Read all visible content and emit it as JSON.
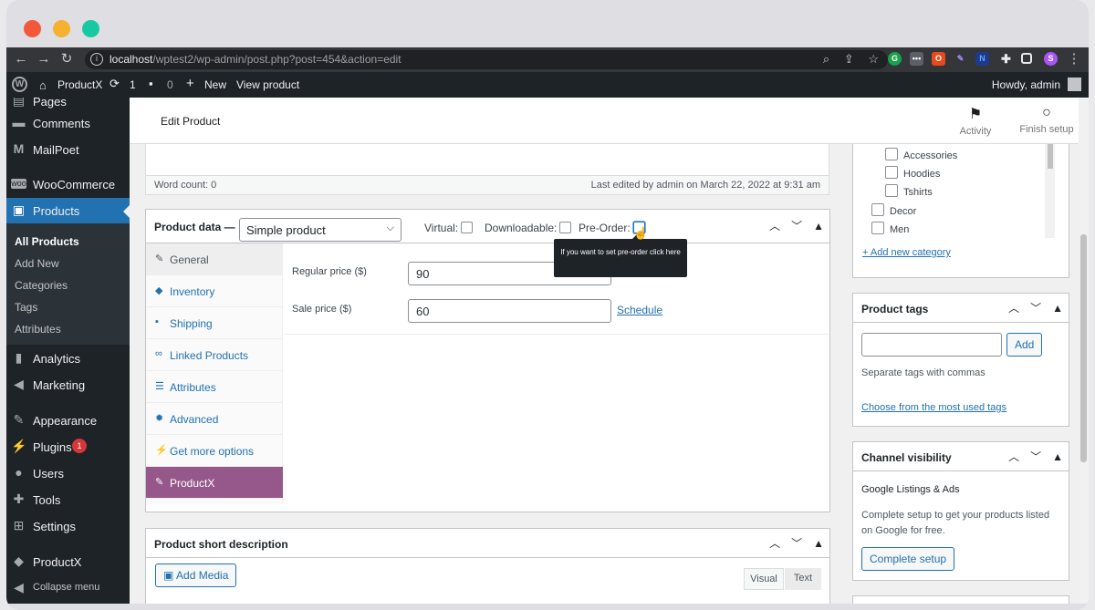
{
  "browser": {
    "url_host": "localhost",
    "url_path": "/wptest2/wp-admin/post.php?post=454&action=edit",
    "profile_initial": "S"
  },
  "adminbar": {
    "site_name": "ProductX",
    "updates_count": "1",
    "comments_count": "0",
    "new_label": "New",
    "view_label": "View product",
    "greeting": "Howdy, admin"
  },
  "sidebar": {
    "items": [
      {
        "label": "Pages",
        "icon": "pages-icon"
      },
      {
        "label": "Comments",
        "icon": "comments-icon"
      },
      {
        "label": "MailPoet",
        "icon": "mailpoet-icon"
      },
      {
        "label": "WooCommerce",
        "icon": "woocommerce-icon"
      },
      {
        "label": "Products",
        "icon": "products-icon"
      },
      {
        "label": "Analytics",
        "icon": "analytics-icon"
      },
      {
        "label": "Marketing",
        "icon": "marketing-icon"
      },
      {
        "label": "Appearance",
        "icon": "appearance-icon"
      },
      {
        "label": "Plugins",
        "icon": "plugins-icon",
        "badge": "1"
      },
      {
        "label": "Users",
        "icon": "users-icon"
      },
      {
        "label": "Tools",
        "icon": "tools-icon"
      },
      {
        "label": "Settings",
        "icon": "settings-icon"
      },
      {
        "label": "ProductX",
        "icon": "productx-icon"
      },
      {
        "label": "Collapse menu",
        "icon": "collapse-icon"
      }
    ],
    "submenu": [
      "All Products",
      "Add New",
      "Categories",
      "Tags",
      "Attributes"
    ]
  },
  "header": {
    "title": "Edit Product",
    "activity_label": "Activity",
    "finish_label": "Finish setup"
  },
  "editor": {
    "word_count": "Word count: 0",
    "last_edited": "Last edited by admin on March 22, 2022 at 9:31 am"
  },
  "product_data": {
    "title": "Product data —",
    "type_value": "Simple product",
    "virtual_label": "Virtual:",
    "downloadable_label": "Downloadable:",
    "preorder_label": "Pre-Order:",
    "tooltip": "If you want to set pre-order click here",
    "tabs": [
      "General",
      "Inventory",
      "Shipping",
      "Linked Products",
      "Attributes",
      "Advanced",
      "Get more options",
      "ProductX"
    ],
    "regular_price_label": "Regular price ($)",
    "regular_price_value": "90",
    "sale_price_label": "Sale price ($)",
    "sale_price_value": "60",
    "schedule_label": "Schedule"
  },
  "short_description": {
    "title": "Product short description",
    "add_media": "Add Media",
    "visual_tab": "Visual",
    "text_tab": "Text"
  },
  "categories": {
    "items": [
      "Accessories",
      "Hoodies",
      "Tshirts",
      "Decor",
      "Men"
    ],
    "add_new": "+ Add new category"
  },
  "tags": {
    "title": "Product tags",
    "add_button": "Add",
    "help": "Separate tags with commas",
    "most_used": "Choose from the most used tags"
  },
  "channel": {
    "title": "Channel visibility",
    "subtitle": "Google Listings & Ads",
    "description_line1": "Complete setup to get your products listed",
    "description_line2": "on Google for free.",
    "button": "Complete setup"
  }
}
